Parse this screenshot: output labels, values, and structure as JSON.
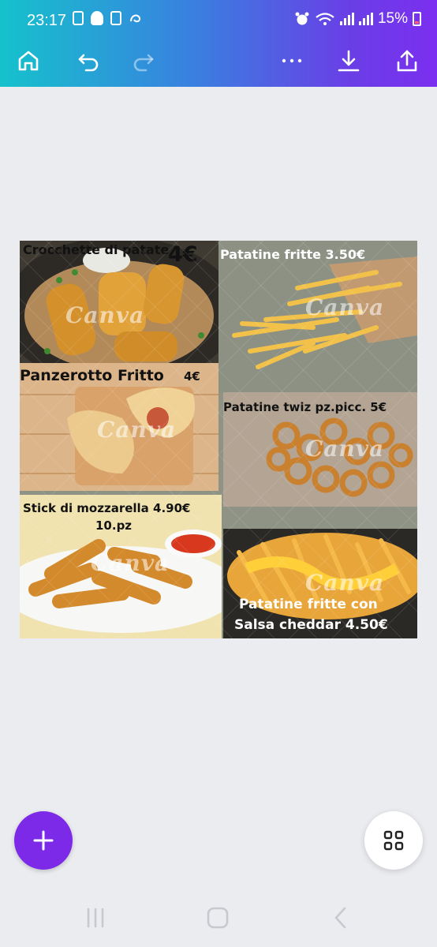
{
  "status_bar": {
    "time": "23:17",
    "battery": "15%"
  },
  "toolbar": {
    "home_icon": "home-icon",
    "undo_icon": "undo-icon",
    "redo_icon": "redo-icon",
    "more_icon": "more-icon",
    "download_icon": "download-icon",
    "share_icon": "share-icon"
  },
  "design": {
    "watermark": "Canva",
    "items": [
      {
        "label": "Crocchette di patate",
        "price": "4€"
      },
      {
        "label": "Patatine fritte  3.50€"
      },
      {
        "label": "Panzerotto Fritto",
        "price": "4€"
      },
      {
        "label": "Patatine twiz pz.picc. 5€"
      },
      {
        "label": "Stick di mozzarella 4.90€",
        "label2": "10.pz"
      },
      {
        "label": "Patatine fritte con",
        "label2": "Salsa cheddar 4.50€"
      }
    ]
  },
  "fab": {
    "add_icon": "plus-icon",
    "pages_icon": "grid-icon"
  },
  "colors": {
    "header_start": "#15c2cc",
    "header_end": "#7b2ff0",
    "accent": "#7d2ae8",
    "background": "#ebecf0"
  }
}
